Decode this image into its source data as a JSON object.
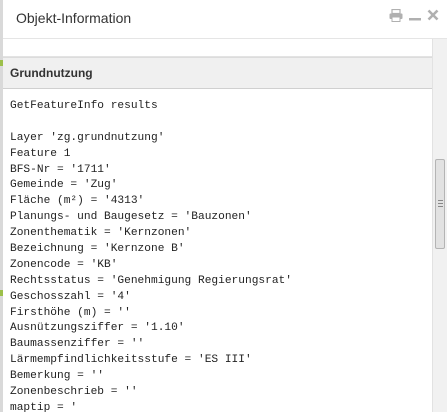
{
  "window": {
    "title": "Objekt-Information"
  },
  "section": {
    "title": "Grundnutzung"
  },
  "results": {
    "heading": "GetFeatureInfo results",
    "layer": "Layer 'zg.grundnutzung'",
    "feature": "Feature 1",
    "lines": [
      "BFS-Nr = '1711'",
      "Gemeinde = 'Zug'",
      "Fläche (m²) = '4313'",
      "Planungs- und Baugesetz = 'Bauzonen'",
      "Zonenthematik = 'Kernzonen'",
      "Bezeichnung = 'Kernzone B'",
      "Zonencode = 'KB'",
      "Rechtsstatus = 'Genehmigung Regierungsrat'",
      "Geschosszahl = '4'",
      "Firsthöhe (m) = ''",
      "Ausnützungsziffer = '1.10'",
      "Baumassenziffer = ''",
      "Lärmempfindlichkeitsstufe = 'ES III'",
      "Bemerkung = ''",
      "Zonenbeschrieb = ''",
      "maptip = '"
    ]
  },
  "icons": {
    "print": "print-icon",
    "minimize": "minimize-icon",
    "close": "close-icon"
  }
}
